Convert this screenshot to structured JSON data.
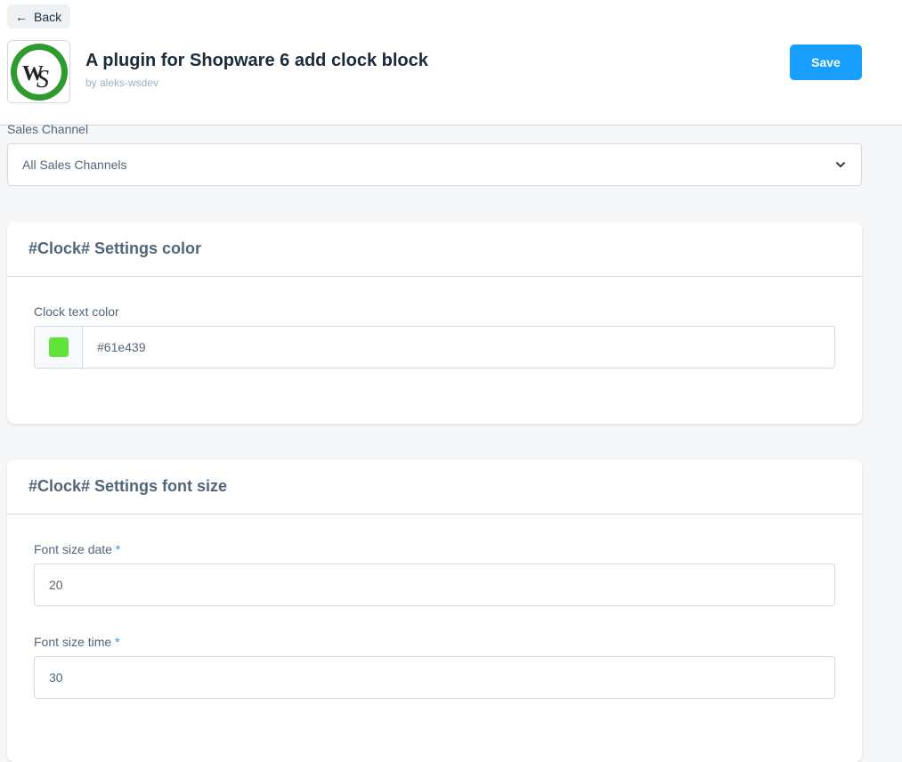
{
  "header": {
    "back_label": "Back",
    "title": "A plugin for Shopware 6 add clock block",
    "author": "by aleks-wsdev",
    "save_label": "Save",
    "logo_text": "WS"
  },
  "sales_channel": {
    "label": "Sales Channel",
    "selected": "All Sales Channels"
  },
  "color_card": {
    "title": "#Clock# Settings color",
    "field_label": "Clock text color",
    "value": "#61e439",
    "swatch_color": "#61e439"
  },
  "font_card": {
    "title": "#Clock# Settings font size",
    "date_label": "Font size date",
    "date_value": "20",
    "time_label": "Font size time",
    "time_value": "30",
    "required_mark": "*"
  },
  "colors": {
    "accent": "#189eff",
    "logo_green": "#2e9b2e"
  }
}
